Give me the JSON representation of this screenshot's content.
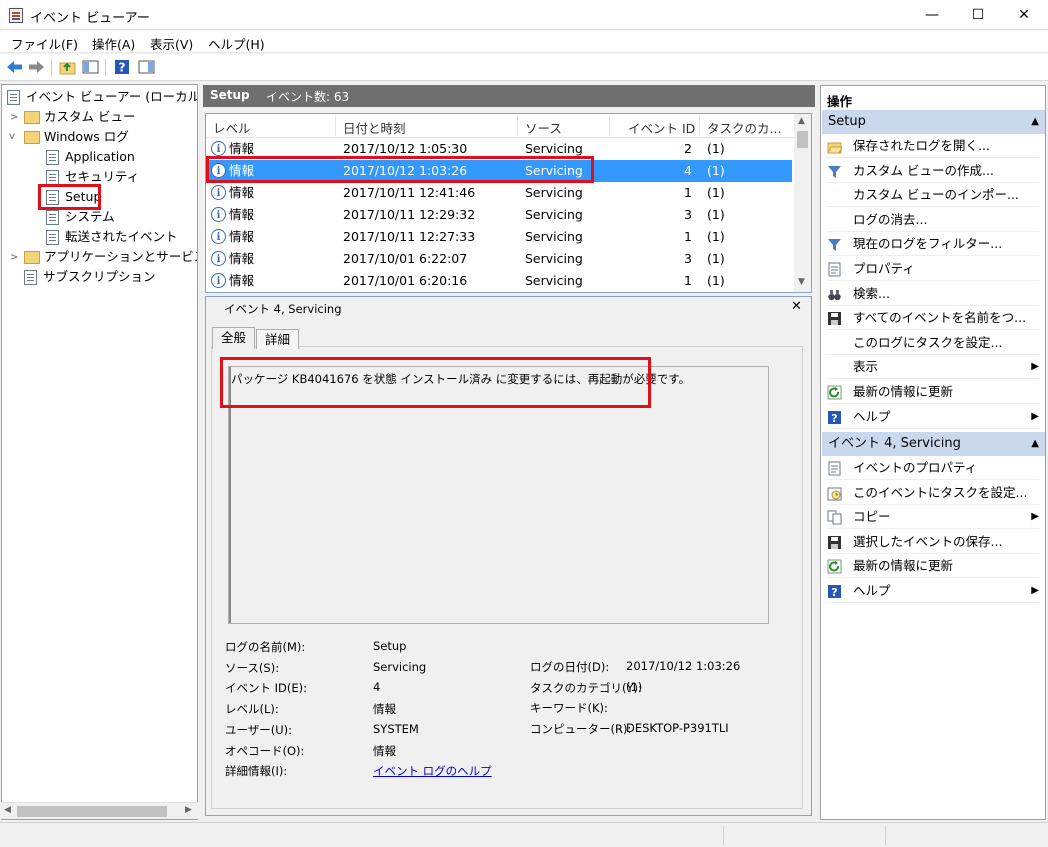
{
  "window": {
    "title": "イベント ビューアー",
    "controls": {
      "minimize": "—",
      "maximize": "☐",
      "close": "✕"
    }
  },
  "menu": [
    "ファイル(F)",
    "操作(A)",
    "表示(V)",
    "ヘルプ(H)"
  ],
  "tree": {
    "root": "イベント ビューアー (ローカル",
    "custom_views": "カスタム ビュー",
    "windows_logs": "Windows ログ",
    "logs": [
      "Application",
      "セキュリティ",
      "Setup",
      "システム",
      "転送されたイベント"
    ],
    "apps_services": "アプリケーションとサービス",
    "subscriptions": "サブスクリプション"
  },
  "center": {
    "log_name": "Setup",
    "event_count_label": "イベント数: 63",
    "columns": [
      "レベル",
      "日付と時刻",
      "ソース",
      "イベント ID",
      "タスクのカ..."
    ],
    "rows": [
      {
        "level": "情報",
        "datetime": "2017/10/12 1:05:30",
        "source": "Servicing",
        "id": "2",
        "task": "(1)"
      },
      {
        "level": "情報",
        "datetime": "2017/10/12 1:03:26",
        "source": "Servicing",
        "id": "4",
        "task": "(1)"
      },
      {
        "level": "情報",
        "datetime": "2017/10/11 12:41:46",
        "source": "Servicing",
        "id": "1",
        "task": "(1)"
      },
      {
        "level": "情報",
        "datetime": "2017/10/11 12:29:32",
        "source": "Servicing",
        "id": "3",
        "task": "(1)"
      },
      {
        "level": "情報",
        "datetime": "2017/10/11 12:27:33",
        "source": "Servicing",
        "id": "1",
        "task": "(1)"
      },
      {
        "level": "情報",
        "datetime": "2017/10/01 6:22:07",
        "source": "Servicing",
        "id": "3",
        "task": "(1)"
      },
      {
        "level": "情報",
        "datetime": "2017/10/01 6:20:16",
        "source": "Servicing",
        "id": "1",
        "task": "(1)"
      }
    ],
    "selected_row": 1
  },
  "detail": {
    "title": "イベント 4, Servicing",
    "close": "✕",
    "tabs": [
      "全般",
      "詳細"
    ],
    "message": "パッケージ KB4041676 を状態 インストール済み に変更するには、再起動が必要です。",
    "props_left": [
      {
        "label": "ログの名前(M):",
        "value": "Setup"
      },
      {
        "label": "ソース(S):",
        "value": "Servicing"
      },
      {
        "label": "イベント ID(E):",
        "value": "4"
      },
      {
        "label": "レベル(L):",
        "value": "情報"
      },
      {
        "label": "ユーザー(U):",
        "value": "SYSTEM"
      },
      {
        "label": "オペコード(O):",
        "value": "情報"
      },
      {
        "label": "詳細情報(I):",
        "value": "イベント ログのヘルプ"
      }
    ],
    "props_right": [
      {
        "label": "ログの日付(D):",
        "value": "2017/10/12 1:03:26"
      },
      {
        "label": "タスクのカテゴリ(Y):",
        "value": "(1)"
      },
      {
        "label": "キーワード(K):",
        "value": ""
      },
      {
        "label": "コンピューター(R):",
        "value": "DESKTOP-P391TLI"
      }
    ]
  },
  "actions": {
    "header": "操作",
    "section1": "Setup",
    "items1": [
      {
        "label": "保存されたログを開く...",
        "icon": "open-folder-icon"
      },
      {
        "label": "カスタム ビューの作成...",
        "icon": "filter-icon"
      },
      {
        "label": "カスタム ビューのインポー...",
        "icon": ""
      },
      {
        "label": "ログの消去...",
        "icon": ""
      },
      {
        "label": "現在のログをフィルター...",
        "icon": "filter-icon"
      },
      {
        "label": "プロパティ",
        "icon": "properties-icon"
      },
      {
        "label": "検索...",
        "icon": "binoculars-icon"
      },
      {
        "label": "すべてのイベントを名前をつ...",
        "icon": "save-icon"
      },
      {
        "label": "このログにタスクを設定...",
        "icon": ""
      },
      {
        "label": "表示",
        "icon": "",
        "submenu": true
      },
      {
        "label": "最新の情報に更新",
        "icon": "refresh-icon"
      },
      {
        "label": "ヘルプ",
        "icon": "help-icon",
        "submenu": true
      }
    ],
    "section2": "イベント 4, Servicing",
    "items2": [
      {
        "label": "イベントのプロパティ",
        "icon": "properties-icon"
      },
      {
        "label": "このイベントにタスクを設定...",
        "icon": "task-icon"
      },
      {
        "label": "コピー",
        "icon": "copy-icon",
        "submenu": true
      },
      {
        "label": "選択したイベントの保存...",
        "icon": "save-icon"
      },
      {
        "label": "最新の情報に更新",
        "icon": "refresh-icon"
      },
      {
        "label": "ヘルプ",
        "icon": "help-icon",
        "submenu": true
      }
    ]
  },
  "colors": {
    "selection": "#3399ff",
    "highlight": "#e0101a",
    "section_header": "#c9d8ec",
    "center_header": "#6f6f6f"
  }
}
